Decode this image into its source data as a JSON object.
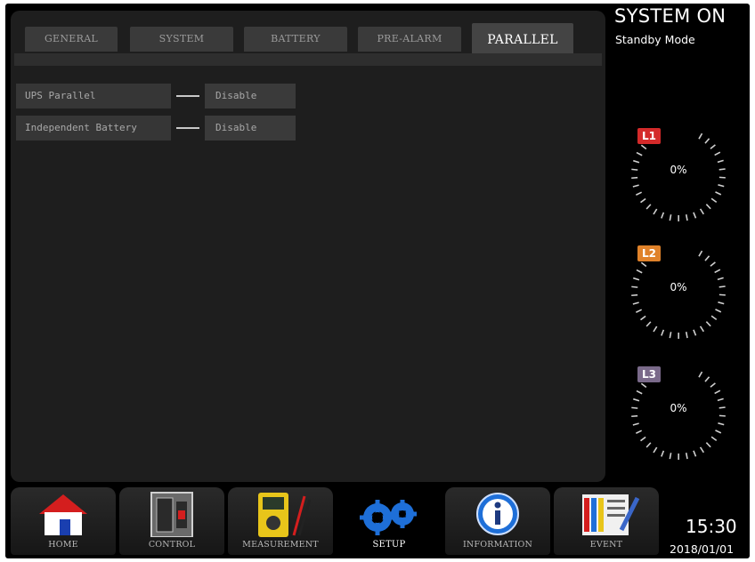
{
  "tabs": [
    {
      "label": "GENERAL",
      "active": false
    },
    {
      "label": "SYSTEM",
      "active": false
    },
    {
      "label": "BATTERY",
      "active": false
    },
    {
      "label": "PRE-ALARM",
      "active": false
    },
    {
      "label": "PARALLEL",
      "active": true
    }
  ],
  "settings": [
    {
      "label": "UPS Parallel",
      "value": "Disable"
    },
    {
      "label": "Independent Battery",
      "value": "Disable"
    }
  ],
  "status": {
    "title": "SYSTEM ON",
    "mode": "Standby Mode"
  },
  "gauges": [
    {
      "label": "L1",
      "value": "0%",
      "color": "#d42a2a"
    },
    {
      "label": "L2",
      "value": "0%",
      "color": "#e0822a"
    },
    {
      "label": "L3",
      "value": "0%",
      "color": "#7a6a8a"
    }
  ],
  "toolbar": [
    {
      "label": "HOME",
      "icon": "home-icon"
    },
    {
      "label": "CONTROL",
      "icon": "control-icon"
    },
    {
      "label": "MEASUREMENT",
      "icon": "multimeter-icon"
    },
    {
      "label": "SETUP",
      "icon": "gears-icon",
      "active": true
    },
    {
      "label": "INFORMATION",
      "icon": "info-icon"
    },
    {
      "label": "EVENT",
      "icon": "event-log-icon"
    }
  ],
  "clock": {
    "time": "15:30",
    "date": "2018/01/01"
  }
}
